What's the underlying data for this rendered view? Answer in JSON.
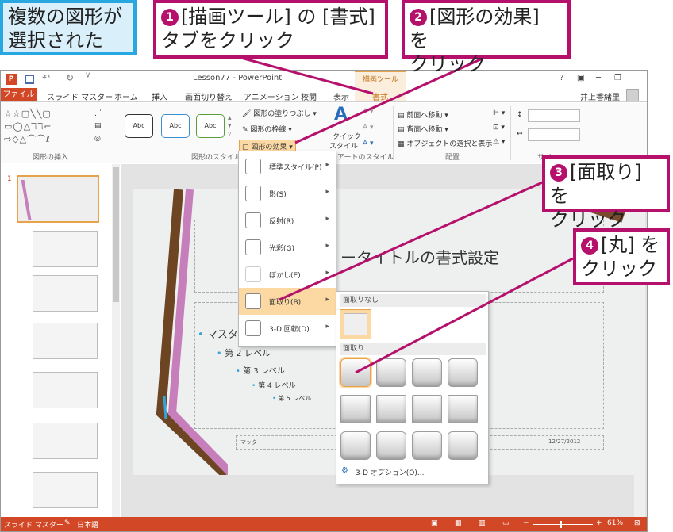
{
  "note": {
    "line1": "複数の図形が",
    "line2": "選択された"
  },
  "callouts": [
    {
      "num": "❶",
      "line1": "[描画ツール] の [書式]",
      "line2": "タブをクリック"
    },
    {
      "num": "❷",
      "line1": "[図形の効果] を",
      "line2": "クリック"
    },
    {
      "num": "❸",
      "line1": "[面取り] を",
      "line2": "クリック"
    },
    {
      "num": "❹",
      "line1": "[丸] を",
      "line2": "クリック"
    }
  ],
  "window": {
    "title": "Lesson77 - PowerPoint",
    "context_tab_title": "描画ツール",
    "help": "?",
    "user": "井上香緒里"
  },
  "tabs": {
    "file": "ファイル",
    "items": [
      "スライド マスター",
      "ホーム",
      "挿入",
      "画面切り替え",
      "アニメーション",
      "校閲",
      "表示"
    ],
    "format": "書式"
  },
  "ribbon": {
    "group_insert_shapes": "図形の挿入",
    "group_shape_styles": "図形のスタイル",
    "style_box": "Abc",
    "shape_fill": "図形の塗りつぶし",
    "shape_outline": "図形の枠線",
    "shape_effects": "図形の効果",
    "quick_styles_1": "クイック",
    "quick_styles_2": "スタイル",
    "group_wordart_styles": "アートのスタイル",
    "bring_forward": "前面へ移動",
    "send_backward": "背面へ移動",
    "selection_pane": "オブジェクトの選択と表示",
    "group_arrange": "配置",
    "group_size": "サイ"
  },
  "effects_menu": [
    {
      "label": "標準スタイル(P)"
    },
    {
      "label": "影(S)"
    },
    {
      "label": "反射(R)"
    },
    {
      "label": "光彩(G)"
    },
    {
      "label": "ぼかし(E)"
    },
    {
      "label": "面取り(B)"
    },
    {
      "label": "3-D 回転(D)"
    }
  ],
  "bevel_menu": {
    "no_bevel": "面取りなし",
    "bevel": "面取り",
    "options": "3-D オプション(O)..."
  },
  "slide": {
    "title": "ータイトルの書式設定",
    "l1": "マスタ",
    "l2": "第 2 レベル",
    "l3": "第 3 レベル",
    "l4": "第 4 レベル",
    "l5": "第 5 レベル",
    "footer_left": "マッター",
    "footer_date": "12/27/2012"
  },
  "thumbs": {
    "first_number": "1"
  },
  "status": {
    "view": "スライド マスター",
    "lang": "日本語",
    "zoom": "61%"
  },
  "colors": {
    "accent": "#b5106c",
    "ppt": "#d24726",
    "note_border": "#29a7e1"
  }
}
